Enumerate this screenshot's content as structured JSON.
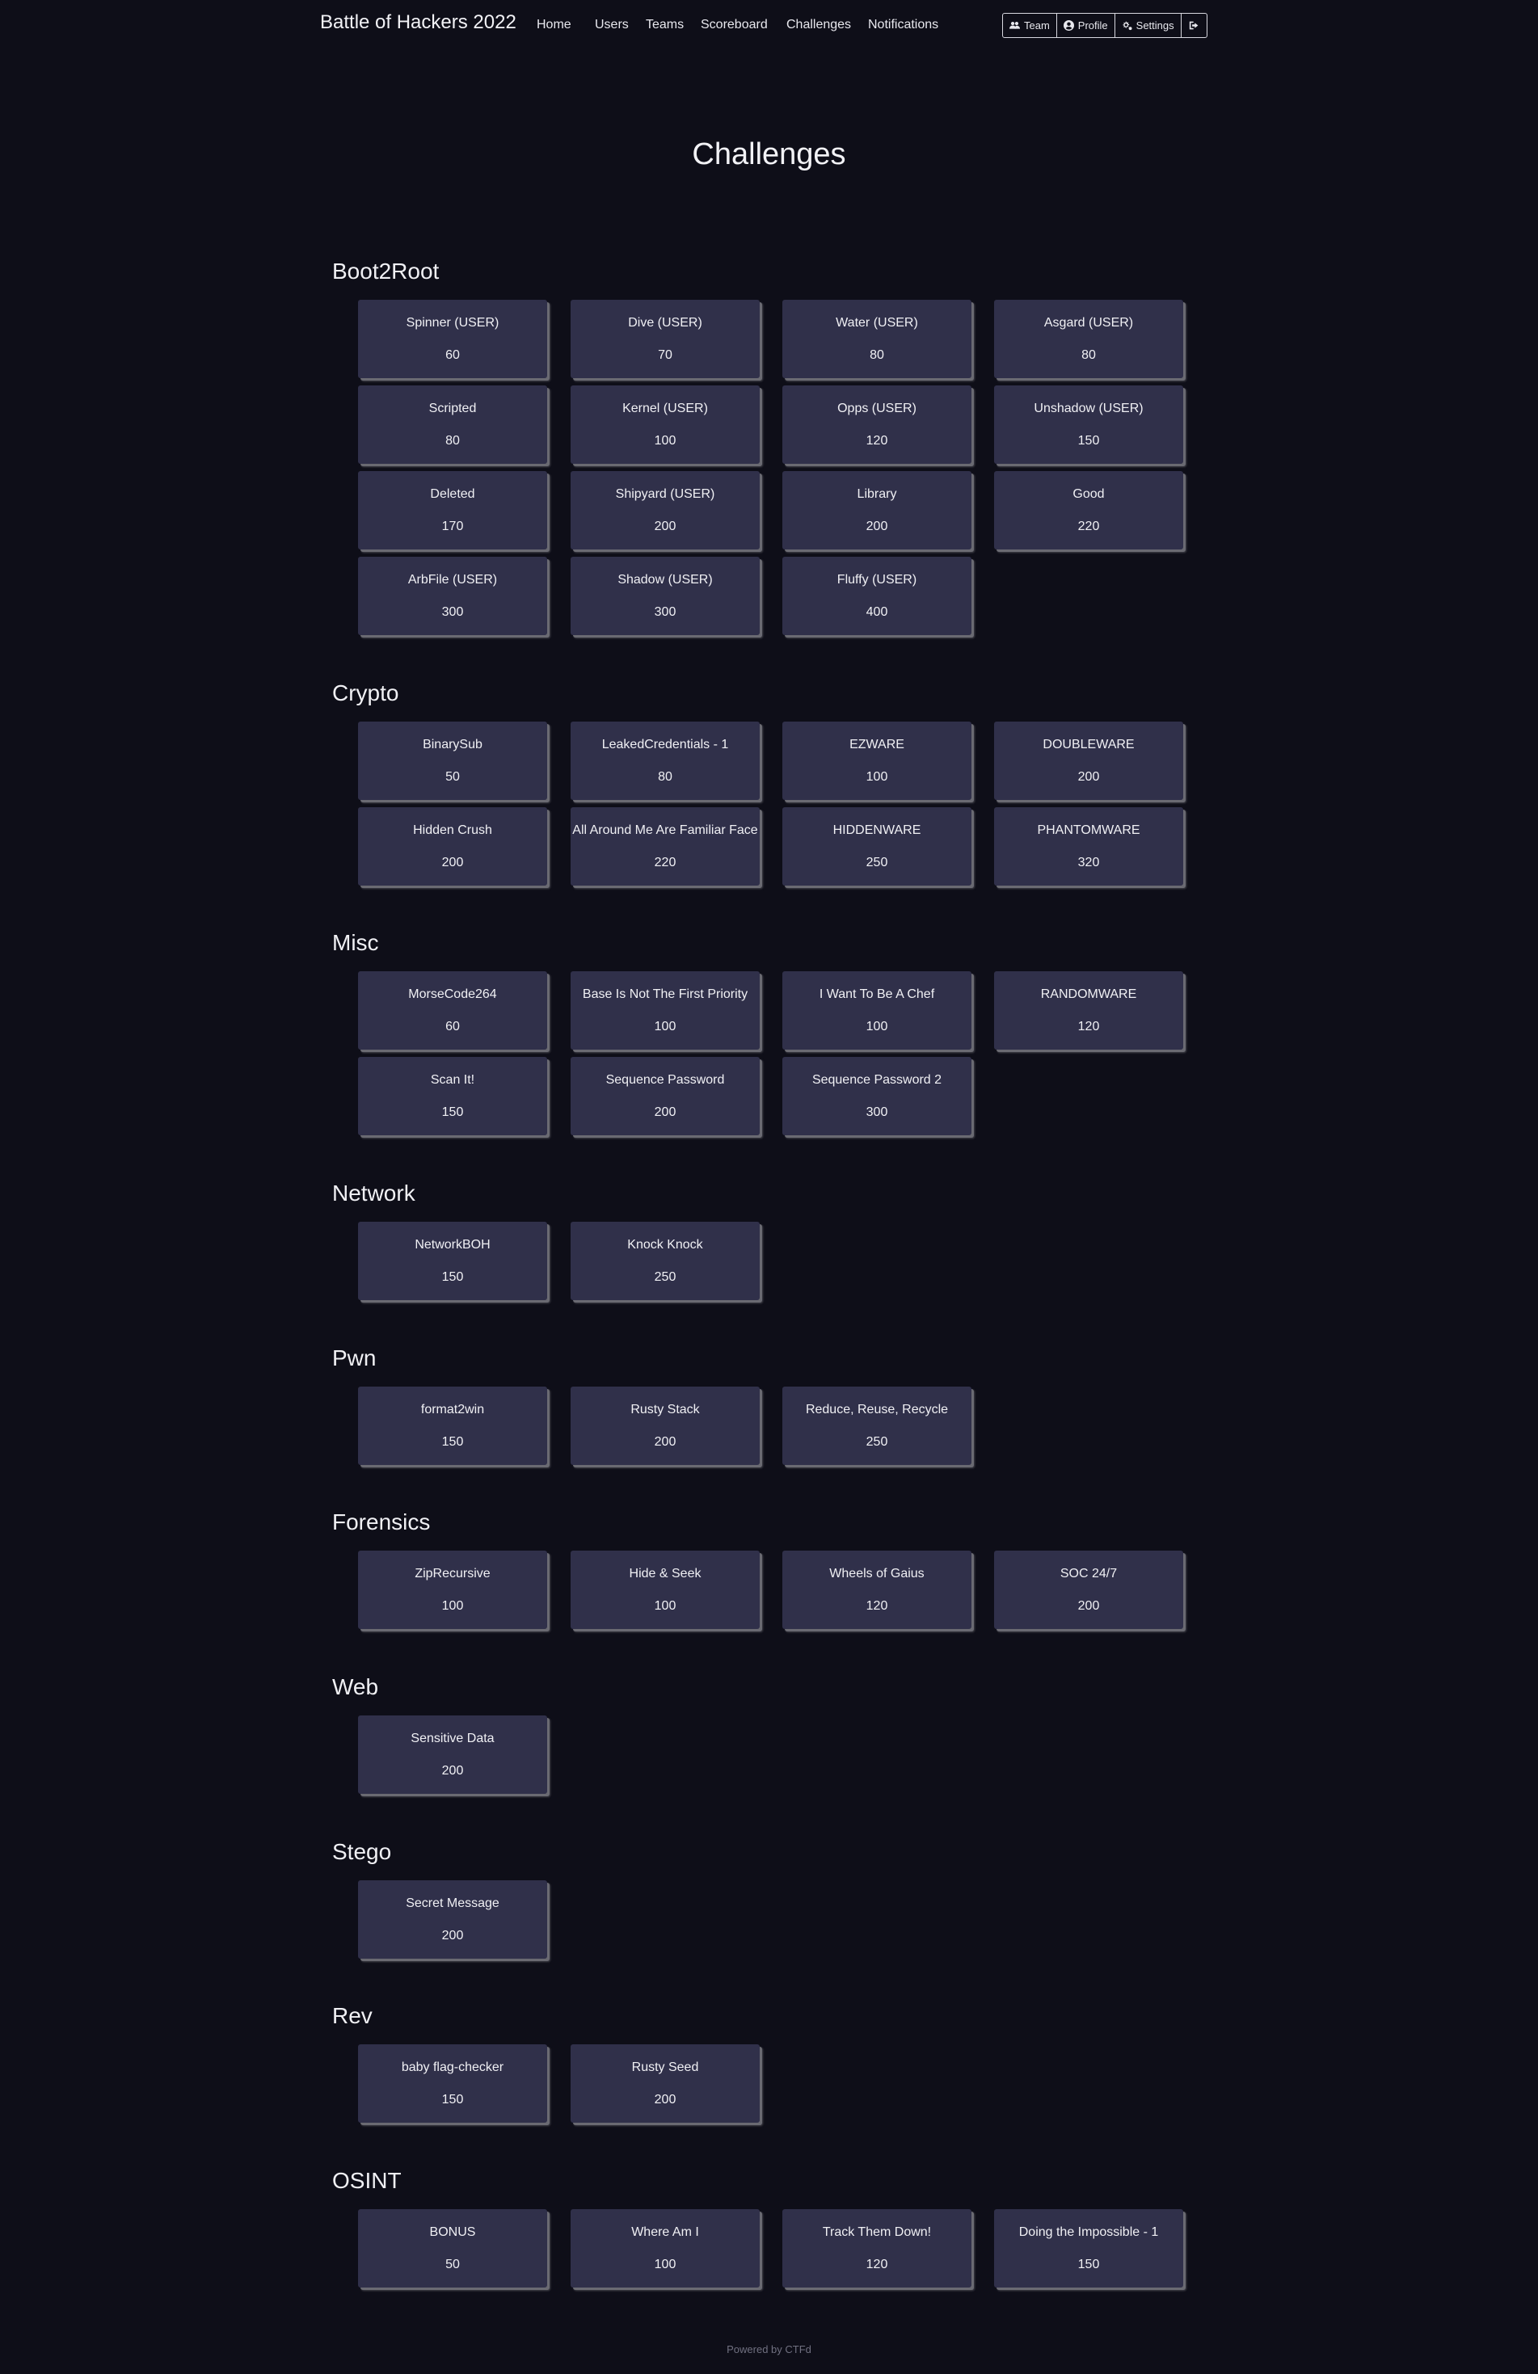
{
  "brand": "Battle of Hackers 2022",
  "nav": [
    "Home",
    "Users",
    "Teams",
    "Scoreboard",
    "Challenges",
    "Notifications"
  ],
  "user_menu": {
    "team": "Team",
    "profile": "Profile",
    "settings": "Settings",
    "logout_icon": "sign-out-icon"
  },
  "page_title": "Challenges",
  "categories": [
    {
      "name": "Boot2Root",
      "challenges": [
        {
          "name": "Spinner (USER)",
          "value": "60"
        },
        {
          "name": "Dive (USER)",
          "value": "70"
        },
        {
          "name": "Water (USER)",
          "value": "80"
        },
        {
          "name": "Asgard (USER)",
          "value": "80"
        },
        {
          "name": "Scripted",
          "value": "80"
        },
        {
          "name": "Kernel (USER)",
          "value": "100"
        },
        {
          "name": "Opps (USER)",
          "value": "120"
        },
        {
          "name": "Unshadow (USER)",
          "value": "150"
        },
        {
          "name": "Deleted",
          "value": "170"
        },
        {
          "name": "Shipyard (USER)",
          "value": "200"
        },
        {
          "name": "Library",
          "value": "200"
        },
        {
          "name": "Good",
          "value": "220"
        },
        {
          "name": "ArbFile (USER)",
          "value": "300"
        },
        {
          "name": "Shadow (USER)",
          "value": "300"
        },
        {
          "name": "Fluffy (USER)",
          "value": "400"
        }
      ]
    },
    {
      "name": "Crypto",
      "challenges": [
        {
          "name": "BinarySub",
          "value": "50"
        },
        {
          "name": "LeakedCredentials - 1",
          "value": "80"
        },
        {
          "name": "EZWARE",
          "value": "100"
        },
        {
          "name": "DOUBLEWARE",
          "value": "200"
        },
        {
          "name": "Hidden Crush",
          "value": "200"
        },
        {
          "name": "All Around Me Are Familiar Face",
          "value": "220"
        },
        {
          "name": "HIDDENWARE",
          "value": "250"
        },
        {
          "name": "PHANTOMWARE",
          "value": "320"
        }
      ]
    },
    {
      "name": "Misc",
      "challenges": [
        {
          "name": "MorseCode264",
          "value": "60"
        },
        {
          "name": "Base Is Not The First Priority",
          "value": "100"
        },
        {
          "name": "I Want To Be A Chef",
          "value": "100"
        },
        {
          "name": "RANDOMWARE",
          "value": "120"
        },
        {
          "name": "Scan It!",
          "value": "150"
        },
        {
          "name": "Sequence Password",
          "value": "200"
        },
        {
          "name": "Sequence Password 2",
          "value": "300"
        }
      ]
    },
    {
      "name": "Network",
      "challenges": [
        {
          "name": "NetworkBOH",
          "value": "150"
        },
        {
          "name": "Knock Knock",
          "value": "250"
        }
      ]
    },
    {
      "name": "Pwn",
      "challenges": [
        {
          "name": "format2win",
          "value": "150"
        },
        {
          "name": "Rusty Stack",
          "value": "200"
        },
        {
          "name": "Reduce, Reuse, Recycle",
          "value": "250"
        }
      ]
    },
    {
      "name": "Forensics",
      "challenges": [
        {
          "name": "ZipRecursive",
          "value": "100"
        },
        {
          "name": "Hide & Seek",
          "value": "100"
        },
        {
          "name": "Wheels of Gaius",
          "value": "120"
        },
        {
          "name": "SOC 24/7",
          "value": "200"
        }
      ]
    },
    {
      "name": "Web",
      "challenges": [
        {
          "name": "Sensitive Data",
          "value": "200"
        }
      ]
    },
    {
      "name": "Stego",
      "challenges": [
        {
          "name": "Secret Message",
          "value": "200"
        }
      ]
    },
    {
      "name": "Rev",
      "challenges": [
        {
          "name": "baby flag-checker",
          "value": "150"
        },
        {
          "name": "Rusty Seed",
          "value": "200"
        }
      ]
    },
    {
      "name": "OSINT",
      "challenges": [
        {
          "name": "BONUS",
          "value": "50"
        },
        {
          "name": "Where Am I",
          "value": "100"
        },
        {
          "name": "Track Them Down!",
          "value": "120"
        },
        {
          "name": "Doing the Impossible - 1",
          "value": "150"
        }
      ]
    }
  ],
  "footer": "Powered by CTFd"
}
